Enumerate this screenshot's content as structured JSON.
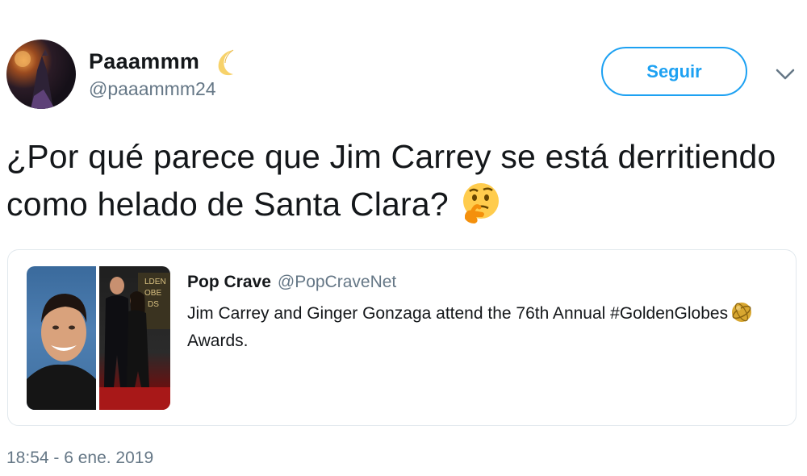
{
  "author": {
    "display_name": "Paaammm",
    "handle": "@paaammm24",
    "name_emoji": "crescent-moon-icon"
  },
  "follow_button": {
    "label": "Seguir"
  },
  "tweet": {
    "text": "¿Por qué parece que Jim Carrey se está derritiendo como helado de Santa Clara?",
    "emoji": "thinking-face-icon"
  },
  "quoted_tweet": {
    "author_name": "Pop Crave",
    "author_handle": "@PopCraveNet",
    "text_before": "Jim Carrey and Ginger Gonzaga attend the 76th Annual #GoldenGlobes",
    "text_after": "Awards.",
    "hashtag_emoji": "golden-globe-icon"
  },
  "timestamp": "18:54 - 6 ene. 2019",
  "colors": {
    "accent": "#1da1f2",
    "text": "#14171a",
    "secondary_text": "#657786",
    "border": "#e1e8ed"
  }
}
